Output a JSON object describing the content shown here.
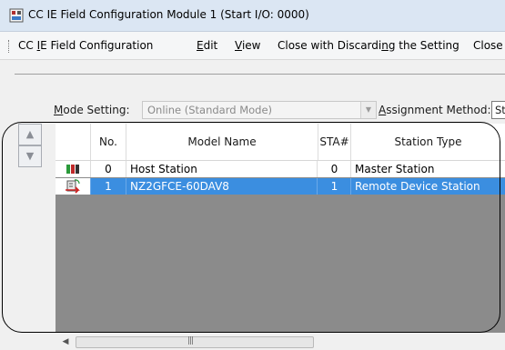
{
  "window": {
    "title": "CC IE Field Configuration Module 1 (Start I/O: 0000)"
  },
  "menu": {
    "items": [
      {
        "label": "CC IE Field Configuration"
      },
      {
        "label": "Edit"
      },
      {
        "label": "View"
      },
      {
        "label": "Close with Discarding the Setting"
      },
      {
        "label": "Close"
      }
    ]
  },
  "settings": {
    "mode_label": "Mode Setting:",
    "mode_value": "Online (Standard Mode)",
    "assignment_label": "Assignment Method:",
    "assignment_value": "St"
  },
  "table": {
    "columns": [
      "No.",
      "Model Name",
      "STA#",
      "Station Type"
    ],
    "rows": [
      {
        "no": "0",
        "model": "Host Station",
        "sta": "0",
        "type": "Master Station",
        "icon": "master-station-icon",
        "selected": false
      },
      {
        "no": "1",
        "model": "NZ2GFCE-60DAV8",
        "sta": "1",
        "type": "Remote Device Station",
        "icon": "remote-device-icon",
        "selected": true
      }
    ]
  },
  "tools": {
    "up_icon": "up-arrow-icon",
    "down_icon": "down-arrow-icon"
  },
  "colors": {
    "selection": "#3b8ee0",
    "grid_background": "#8b8b8b",
    "title_bar": "#dbe6f3"
  }
}
